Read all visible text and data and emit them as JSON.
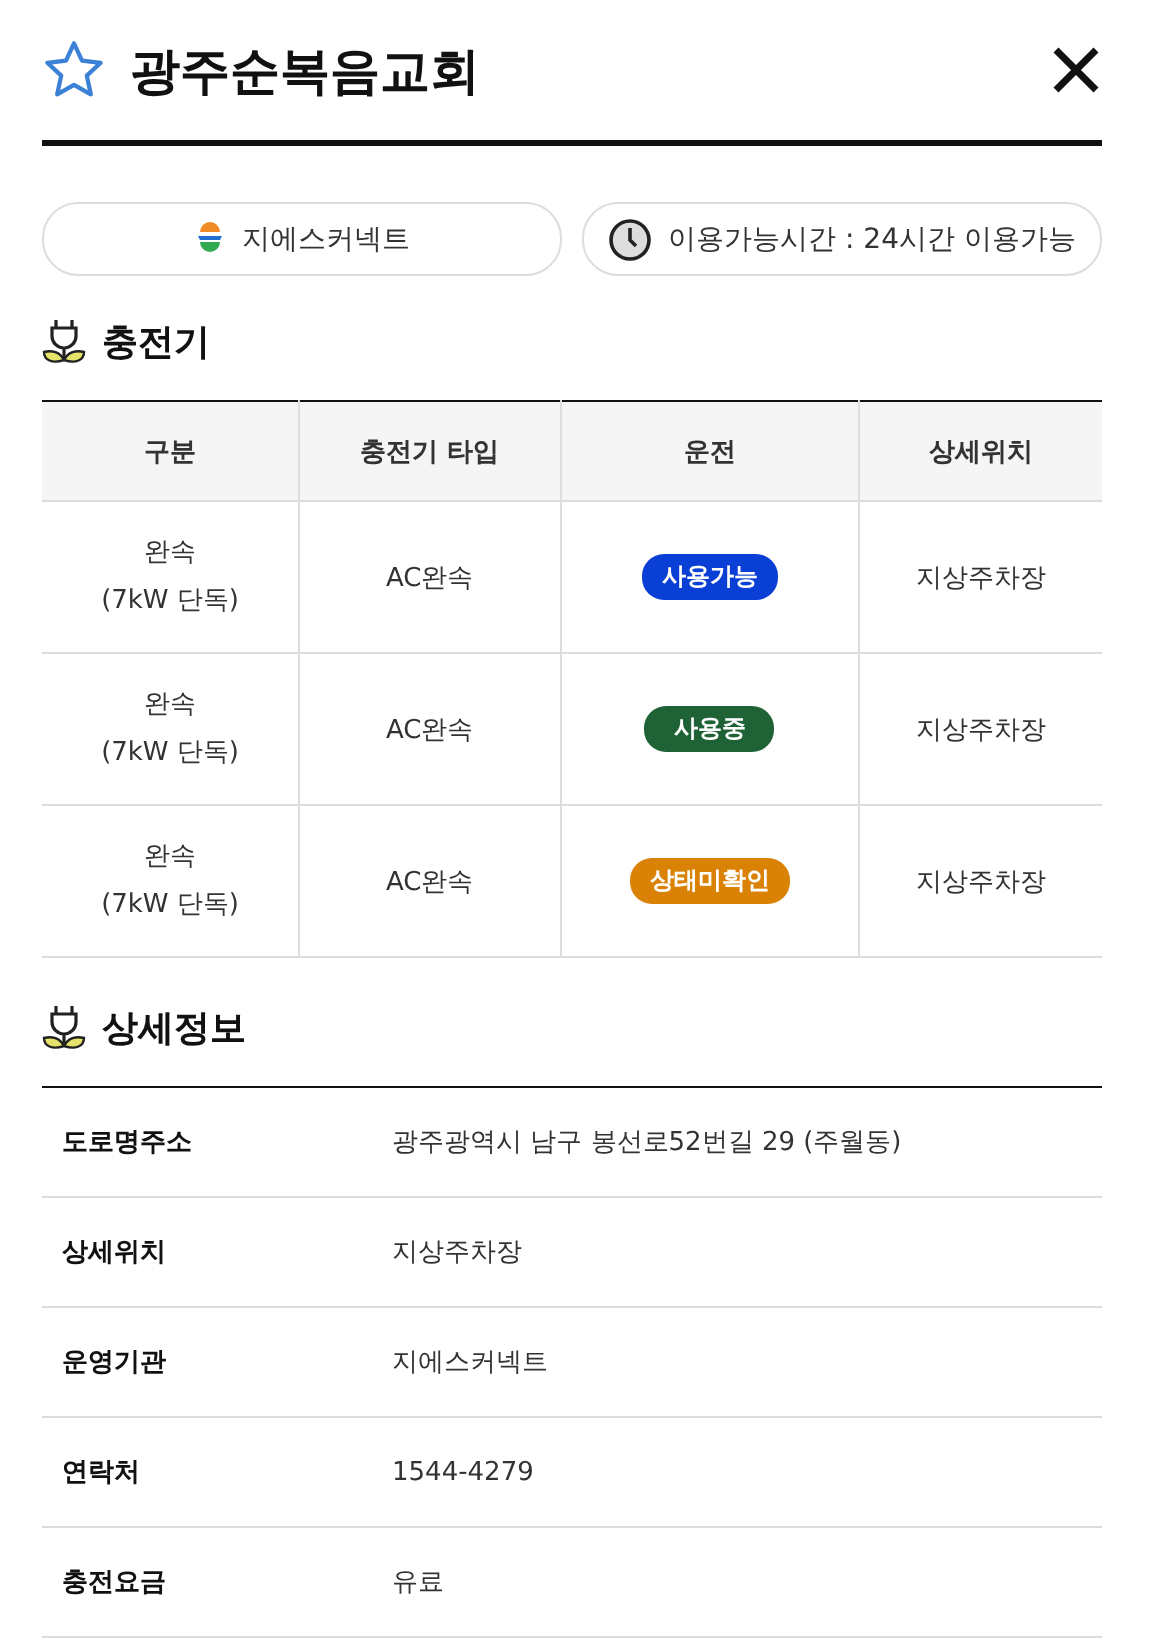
{
  "header": {
    "title": "광주순복음교회",
    "favorite": false
  },
  "info_pills": [
    {
      "kind": "operator",
      "text": "지에스커넥트"
    },
    {
      "kind": "hours",
      "text": "이용가능시간 : 24시간 이용가능"
    }
  ],
  "chargers": {
    "heading": "충전기",
    "columns": [
      "구분",
      "충전기 타입",
      "운전",
      "상세위치"
    ],
    "rows": [
      {
        "type_line1": "완속",
        "type_line2": "(7kW 단독)",
        "charger_type": "AC완속",
        "status": {
          "label": "사용가능",
          "color": "#0a3fd6"
        },
        "location": "지상주차장"
      },
      {
        "type_line1": "완속",
        "type_line2": "(7kW 단독)",
        "charger_type": "AC완속",
        "status": {
          "label": "사용중",
          "color": "#1f6236"
        },
        "location": "지상주차장"
      },
      {
        "type_line1": "완속",
        "type_line2": "(7kW 단독)",
        "charger_type": "AC완속",
        "status": {
          "label": "상태미확인",
          "color": "#d98206"
        },
        "location": "지상주차장"
      }
    ]
  },
  "details": {
    "heading": "상세정보",
    "rows": [
      {
        "label": "도로명주소",
        "value": "광주광역시 남구 봉선로52번길 29 (주월동)"
      },
      {
        "label": "상세위치",
        "value": "지상주차장"
      },
      {
        "label": "운영기관",
        "value": "지에스커넥트"
      },
      {
        "label": "연락처",
        "value": "1544-4279"
      },
      {
        "label": "충전요금",
        "value": "유료"
      }
    ]
  }
}
